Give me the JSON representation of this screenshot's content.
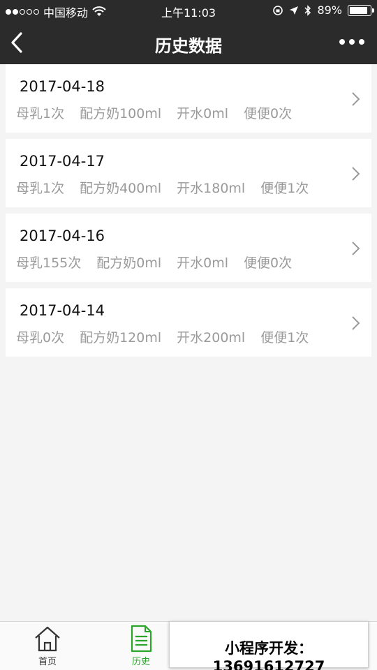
{
  "status_bar": {
    "carrier": "中国移动",
    "time": "上午11:03",
    "battery_text": "89%",
    "battery_level": 0.89
  },
  "navbar": {
    "title": "历史数据"
  },
  "records": [
    {
      "date": "2017-04-18",
      "breast": "母乳1次",
      "formula": "配方奶100ml",
      "water": "开水0ml",
      "stool": "便便0次"
    },
    {
      "date": "2017-04-17",
      "breast": "母乳1次",
      "formula": "配方奶400ml",
      "water": "开水180ml",
      "stool": "便便1次"
    },
    {
      "date": "2017-04-16",
      "breast": "母乳155次",
      "formula": "配方奶0ml",
      "water": "开水0ml",
      "stool": "便便0次"
    },
    {
      "date": "2017-04-14",
      "breast": "母乳0次",
      "formula": "配方奶120ml",
      "water": "开水200ml",
      "stool": "便便1次"
    }
  ],
  "tabbar": {
    "home_label": "首页",
    "history_label": "历史",
    "active_color": "#2aa52a"
  },
  "promo": {
    "text": "小程序开发：13691612727"
  }
}
